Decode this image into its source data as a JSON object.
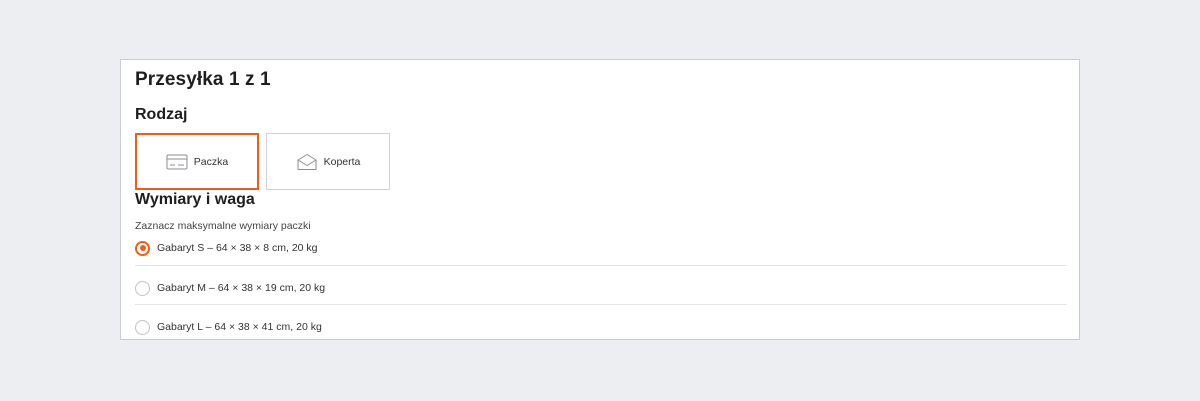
{
  "shipment": {
    "title": "Przesyłka 1 z 1"
  },
  "type_section": {
    "title": "Rodzaj",
    "options": [
      {
        "label": "Paczka",
        "icon": "package-icon",
        "selected": true
      },
      {
        "label": "Koperta",
        "icon": "envelope-icon",
        "selected": false
      }
    ]
  },
  "dimensions_section": {
    "title": "Wymiary i waga",
    "hint": "Zaznacz maksymalne wymiary paczki",
    "options": [
      {
        "label": "Gabaryt S – 64 × 38 × 8 cm, 20 kg",
        "selected": true
      },
      {
        "label": "Gabaryt M – 64 × 38 × 19 cm, 20 kg",
        "selected": false
      },
      {
        "label": "Gabaryt L – 64 × 38 × 41 cm, 20 kg",
        "selected": false
      }
    ]
  },
  "colors": {
    "accent": "#f25c19",
    "border": "#c9ccd1",
    "background": "#eceef1"
  }
}
